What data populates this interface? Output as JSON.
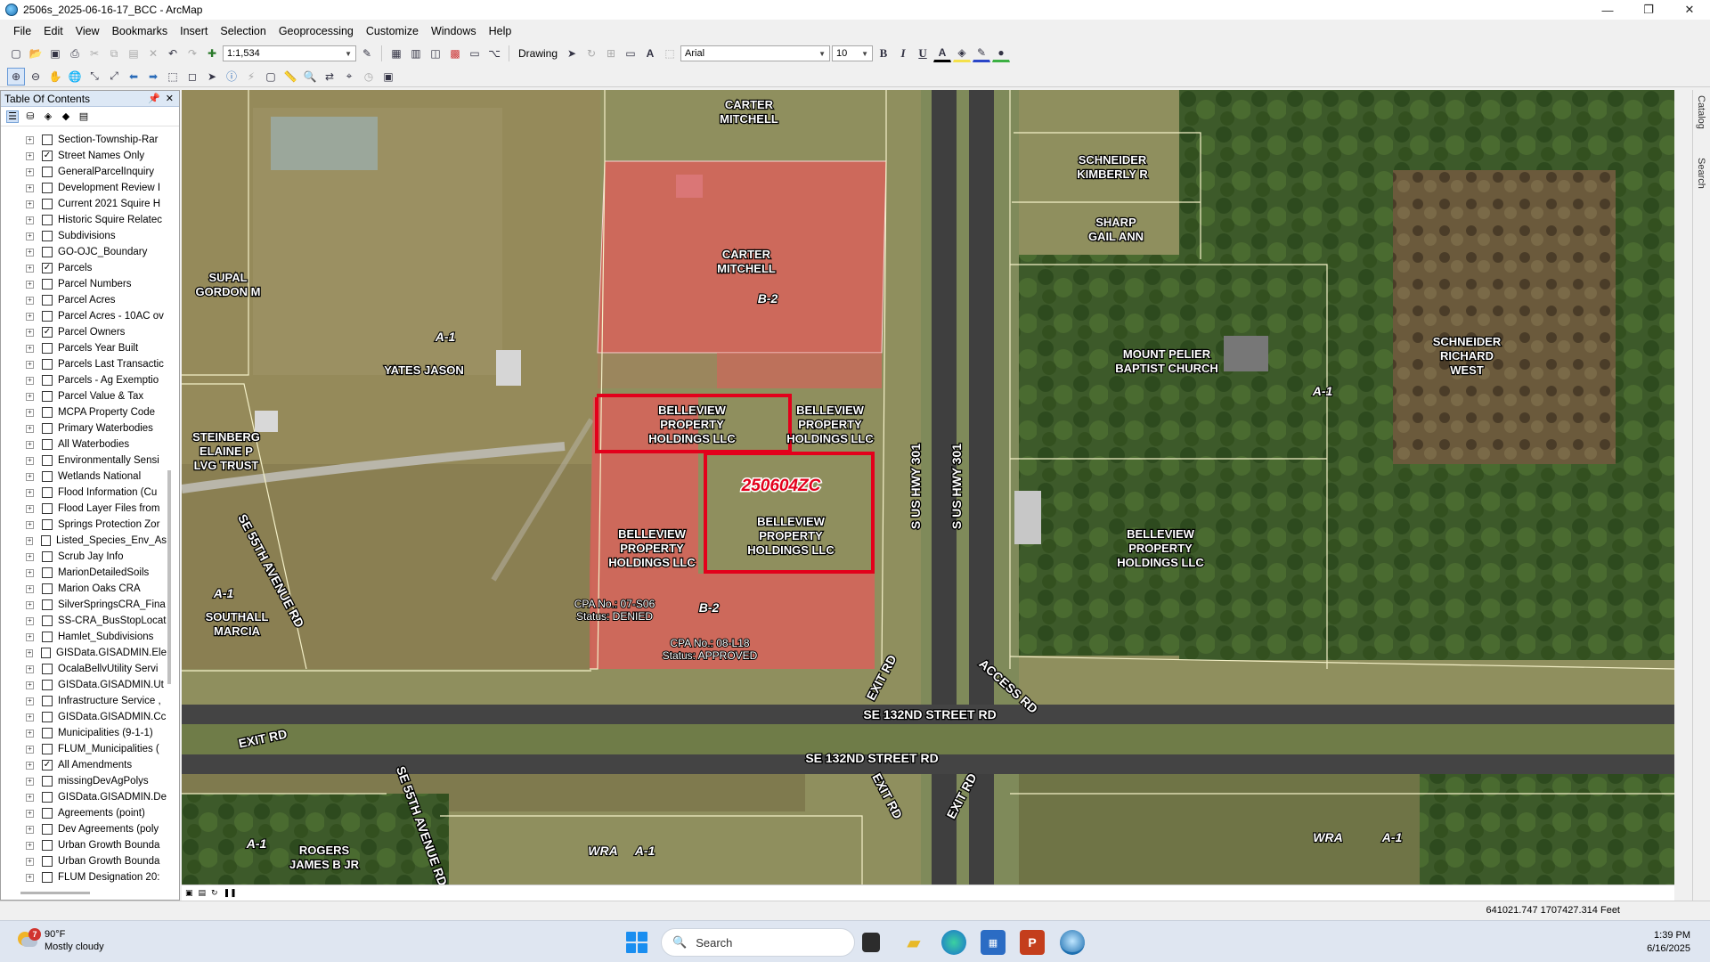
{
  "window": {
    "title": "2506s_2025-06-16-17_BCC - ArcMap",
    "minimize": "—",
    "maximize": "❐",
    "close": "✕"
  },
  "menu": [
    "File",
    "Edit",
    "View",
    "Bookmarks",
    "Insert",
    "Selection",
    "Geoprocessing",
    "Customize",
    "Windows",
    "Help"
  ],
  "toolbar": {
    "scale": "1:1,534",
    "drawing_label": "Drawing",
    "font_name": "Arial",
    "font_size": "10",
    "bold": "B",
    "italic": "I",
    "underline": "U"
  },
  "toc": {
    "title": "Table Of Contents",
    "layers": [
      {
        "name": "Section-Township-Rar",
        "checked": false
      },
      {
        "name": "Street Names Only",
        "checked": true
      },
      {
        "name": "GeneralParcelInquiry",
        "checked": false
      },
      {
        "name": "Development Review I",
        "checked": false
      },
      {
        "name": "Current 2021 Squire H",
        "checked": false
      },
      {
        "name": "Historic Squire Relatec",
        "checked": false
      },
      {
        "name": "Subdivisions",
        "checked": false
      },
      {
        "name": "GO-OJC_Boundary",
        "checked": false
      },
      {
        "name": "Parcels",
        "checked": true
      },
      {
        "name": "Parcel Numbers",
        "checked": false
      },
      {
        "name": "Parcel Acres",
        "checked": false
      },
      {
        "name": "Parcel Acres - 10AC ov",
        "checked": false
      },
      {
        "name": "Parcel Owners",
        "checked": true
      },
      {
        "name": "Parcels Year Built",
        "checked": false
      },
      {
        "name": "Parcels Last Transactic",
        "checked": false
      },
      {
        "name": "Parcels - Ag Exemptio",
        "checked": false
      },
      {
        "name": "Parcel Value & Tax",
        "checked": false
      },
      {
        "name": "MCPA Property Code",
        "checked": false
      },
      {
        "name": "Primary Waterbodies",
        "checked": false
      },
      {
        "name": "All Waterbodies",
        "checked": false
      },
      {
        "name": "Environmentally Sensi",
        "checked": false
      },
      {
        "name": "Wetlands National",
        "checked": false
      },
      {
        "name": "Flood Information (Cu",
        "checked": false
      },
      {
        "name": "Flood Layer Files from",
        "checked": false
      },
      {
        "name": "Springs Protection Zor",
        "checked": false
      },
      {
        "name": "Listed_Species_Env_As",
        "checked": false
      },
      {
        "name": "Scrub Jay Info",
        "checked": false
      },
      {
        "name": "MarionDetailedSoils",
        "checked": false
      },
      {
        "name": "Marion Oaks CRA",
        "checked": false
      },
      {
        "name": "SilverSpringsCRA_Fina",
        "checked": false
      },
      {
        "name": "SS-CRA_BusStopLocat",
        "checked": false
      },
      {
        "name": "Hamlet_Subdivisions",
        "checked": false
      },
      {
        "name": "GISData.GISADMIN.Ele",
        "checked": false
      },
      {
        "name": "OcalaBellvUtility Servi",
        "checked": false
      },
      {
        "name": "GISData.GISADMIN.Ut",
        "checked": false
      },
      {
        "name": "Infrastructure Service ,",
        "checked": false
      },
      {
        "name": "GISData.GISADMIN.Cc",
        "checked": false
      },
      {
        "name": "Municipalities (9-1-1)",
        "checked": false
      },
      {
        "name": "FLUM_Municipalities (",
        "checked": false
      },
      {
        "name": "All Amendments",
        "checked": true
      },
      {
        "name": "missingDevAgPolys",
        "checked": false
      },
      {
        "name": "GISData.GISADMIN.De",
        "checked": false
      },
      {
        "name": "Agreements (point)",
        "checked": false
      },
      {
        "name": "Dev Agreements (poly",
        "checked": false
      },
      {
        "name": "Urban Growth Bounda",
        "checked": false
      },
      {
        "name": "Urban Growth Bounda",
        "checked": false
      },
      {
        "name": "FLUM Designation 20:",
        "checked": false
      }
    ]
  },
  "map": {
    "case_id": "250604ZC",
    "owners": {
      "carter_top": [
        "CARTER",
        "MITCHELL"
      ],
      "carter_main": [
        "CARTER",
        "MITCHELL"
      ],
      "schneider_k": [
        "SCHNEIDER",
        "KIMBERLY R"
      ],
      "sharp": [
        "SHARP",
        "GAIL ANN"
      ],
      "mount_pelier": [
        "MOUNT PELIER",
        "BAPTIST CHURCH"
      ],
      "schneider_r": [
        "SCHNEIDER",
        "RICHARD",
        "WEST"
      ],
      "supal": [
        "SUPAL",
        "GORDON M"
      ],
      "yates": "YATES JASON",
      "steinberg": [
        "STEINBERG",
        "ELAINE P",
        "LVG TRUST"
      ],
      "belleview_1": [
        "BELLEVIEW",
        "PROPERTY",
        "HOLDINGS LLC"
      ],
      "belleview_2": [
        "BELLEVIEW",
        "PROPERTY",
        "HOLDINGS LLC"
      ],
      "belleview_3": [
        "BELLEVIEW",
        "PROPERTY",
        "HOLDINGS LLC"
      ],
      "belleview_4": [
        "BELLEVIEW",
        "PROPERTY",
        "HOLDINGS LLC"
      ],
      "belleview_5": [
        "BELLEVIEW",
        "PROPERTY",
        "HOLDINGS LLC"
      ],
      "southall": [
        "SOUTHALL",
        "MARCIA"
      ],
      "rogers": [
        "ROGERS",
        "JAMES B JR"
      ]
    },
    "zoning": {
      "b2": "B-2",
      "a1": "A-1",
      "wra": "WRA"
    },
    "cpa1": [
      "CPA No.: 07-S06",
      "Status: DENIED"
    ],
    "cpa2": [
      "CPA No.: 08-L18",
      "Status: APPROVED"
    ],
    "roads": {
      "us301": "S US HWY 301",
      "se132": "SE 132ND STREET RD",
      "se55": "SE 55TH AVENUE RD",
      "exit": "EXIT RD",
      "access": "ACCESS RD"
    }
  },
  "dock": {
    "catalog": "Catalog",
    "search": "Search"
  },
  "status": {
    "coords": "641021.747  1707427.314 Feet"
  },
  "taskbar": {
    "weather_temp": "90°F",
    "weather_desc": "Mostly cloudy",
    "weather_badge": "7",
    "search_placeholder": "Search",
    "time": "1:39 PM",
    "date": "6/16/2025"
  },
  "colors": {
    "parcel_highlight": "#e3001b",
    "amendment_fill": "#e45a5a"
  }
}
